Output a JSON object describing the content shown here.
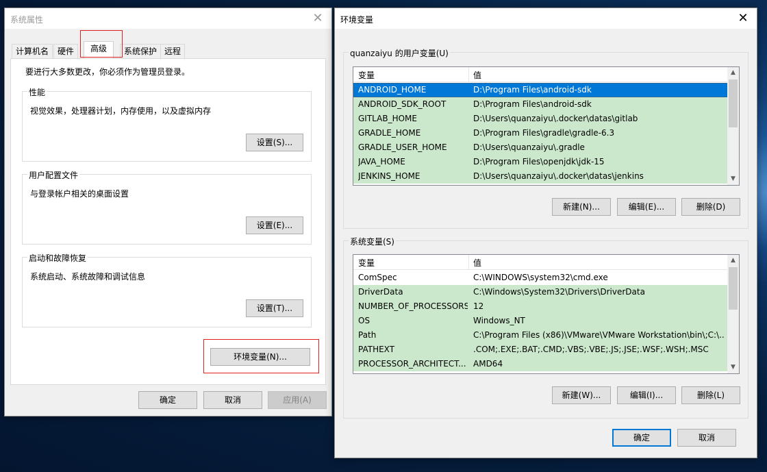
{
  "sys": {
    "title": "系统属性",
    "tabs": [
      "计算机名",
      "硬件",
      "高级",
      "系统保护",
      "远程"
    ],
    "admin_note": "要进行大多数更改，你必须作为管理员登录。",
    "perf": {
      "label": "性能",
      "desc": "视觉效果，处理器计划，内存使用，以及虚拟内存",
      "btn": "设置(S)..."
    },
    "profile": {
      "label": "用户配置文件",
      "desc": "与登录帐户相关的桌面设置",
      "btn": "设置(E)..."
    },
    "startup": {
      "label": "启动和故障恢复",
      "desc": "系统启动、系统故障和调试信息",
      "btn": "设置(T)..."
    },
    "env_btn": "环境变量(N)...",
    "ok": "确定",
    "cancel": "取消",
    "apply": "应用(A)"
  },
  "env": {
    "title": "环境变量",
    "user_label": "quanzaiyu 的用户变量(U)",
    "col_var": "变量",
    "col_val": "值",
    "user_vars": [
      {
        "name": "ANDROID_HOME",
        "value": "D:\\Program Files\\android-sdk"
      },
      {
        "name": "ANDROID_SDK_ROOT",
        "value": "D:\\Program Files\\android-sdk"
      },
      {
        "name": "GITLAB_HOME",
        "value": "D:\\Users\\quanzaiyu\\.docker\\datas\\gitlab"
      },
      {
        "name": "GRADLE_HOME",
        "value": "D:\\Program Files\\gradle\\gradle-6.3"
      },
      {
        "name": "GRADLE_USER_HOME",
        "value": "D:\\Users\\quanzaiyu\\.gradle"
      },
      {
        "name": "JAVA_HOME",
        "value": "D:\\Program Files\\openjdk\\jdk-15"
      },
      {
        "name": "JENKINS_HOME",
        "value": "D:\\Users\\quanzaiyu\\.docker\\datas\\jenkins"
      }
    ],
    "user_btns": [
      "新建(N)...",
      "编辑(E)...",
      "删除(D)"
    ],
    "sys_label": "系统变量(S)",
    "sys_vars": [
      {
        "name": "ComSpec",
        "value": "C:\\WINDOWS\\system32\\cmd.exe"
      },
      {
        "name": "DriverData",
        "value": "C:\\Windows\\System32\\Drivers\\DriverData"
      },
      {
        "name": "NUMBER_OF_PROCESSORS",
        "value": "12"
      },
      {
        "name": "OS",
        "value": "Windows_NT"
      },
      {
        "name": "Path",
        "value": "C:\\Program Files (x86)\\VMware\\VMware Workstation\\bin\\;C:\\..."
      },
      {
        "name": "PATHEXT",
        "value": ".COM;.EXE;.BAT;.CMD;.VBS;.VBE;.JS;.JSE;.WSF;.WSH;.MSC"
      },
      {
        "name": "PROCESSOR_ARCHITECT...",
        "value": "AMD64"
      }
    ],
    "sys_btns": [
      "新建(W)...",
      "编辑(I)...",
      "删除(L)"
    ],
    "ok": "确定",
    "cancel": "取消"
  },
  "colors": {
    "selection": "#0078d7",
    "row_highlight": "#cce8cc",
    "annotation_red": "#e02020"
  }
}
